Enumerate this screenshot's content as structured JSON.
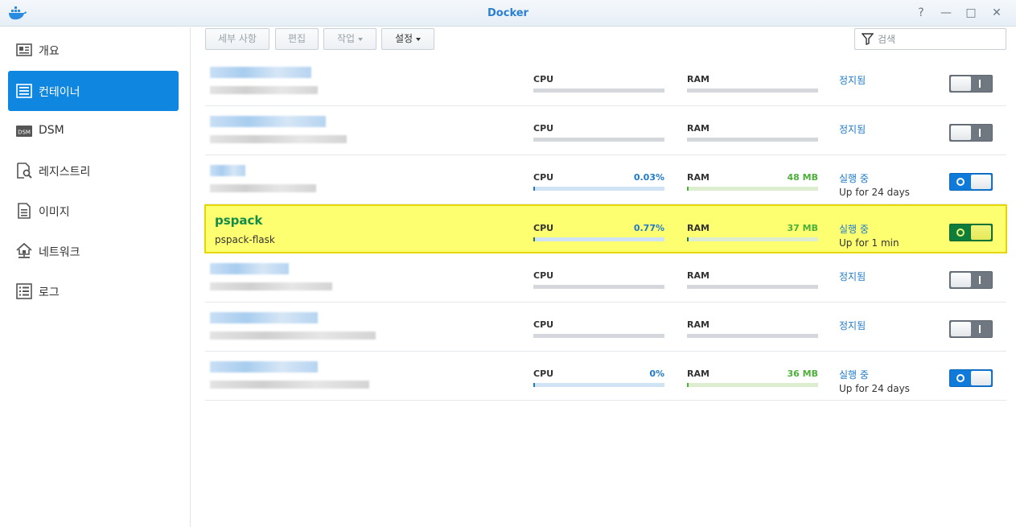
{
  "window": {
    "title": "Docker",
    "buttons": [
      "?",
      "—",
      "□",
      "✕"
    ],
    "app_icon": "docker-whale-icon"
  },
  "sidebar": {
    "items": [
      {
        "label": "개요",
        "icon": "overview-icon",
        "active": false
      },
      {
        "label": "컨테이너",
        "icon": "container-icon",
        "active": true
      },
      {
        "label": "DSM",
        "icon": "dsm-icon",
        "active": false
      },
      {
        "label": "레지스트리",
        "icon": "registry-icon",
        "active": false
      },
      {
        "label": "이미지",
        "icon": "image-icon",
        "active": false
      },
      {
        "label": "네트워크",
        "icon": "network-icon",
        "active": false
      },
      {
        "label": "로그",
        "icon": "log-icon",
        "active": false
      }
    ]
  },
  "toolbar": {
    "details_label": "세부 사항",
    "edit_label": "편집",
    "action_label": "작업",
    "settings_label": "설정",
    "search_placeholder": "검색"
  },
  "labels": {
    "cpu": "CPU",
    "ram": "RAM"
  },
  "containers": [
    {
      "name": "",
      "image": "",
      "blurred": true,
      "cpu": "",
      "ram": "",
      "status": "정지됨",
      "uptime": "",
      "running": false,
      "cpu_fraction": 0,
      "ram_fraction": 0
    },
    {
      "name": "",
      "image": "",
      "blurred": true,
      "cpu": "",
      "ram": "",
      "status": "정지됨",
      "uptime": "",
      "running": false,
      "cpu_fraction": 0,
      "ram_fraction": 0
    },
    {
      "name": "",
      "image": "",
      "blurred": true,
      "cpu": "0.03%",
      "ram": "48 MB",
      "status": "실행 중",
      "uptime": "Up for 24 days",
      "running": true,
      "cpu_fraction": 0.0003,
      "ram_fraction": 0.01
    },
    {
      "name": "pspack",
      "image": "pspack-flask",
      "blurred": false,
      "highlighted": true,
      "cpu": "0.77%",
      "ram": "37 MB",
      "status": "실행 중",
      "uptime": "Up for 1 min",
      "running": true,
      "cpu_fraction": 0.0077,
      "ram_fraction": 0.01
    },
    {
      "name": "",
      "image": "",
      "blurred": true,
      "cpu": "",
      "ram": "",
      "status": "정지됨",
      "uptime": "",
      "running": false,
      "cpu_fraction": 0,
      "ram_fraction": 0
    },
    {
      "name": "",
      "image": "",
      "blurred": true,
      "cpu": "",
      "ram": "",
      "status": "정지됨",
      "uptime": "",
      "running": false,
      "cpu_fraction": 0,
      "ram_fraction": 0
    },
    {
      "name": "",
      "image": "",
      "blurred": true,
      "cpu": "0%",
      "ram": "36 MB",
      "status": "실행 중",
      "uptime": "Up for 24 days",
      "running": true,
      "cpu_fraction": 0,
      "ram_fraction": 0.01
    }
  ],
  "colors": {
    "accent": "#0f86e0",
    "status_text": "#1e7ac9",
    "cpu_value": "#1e7ac9",
    "ram_value": "#4caf3a",
    "highlight": "#feff70",
    "running_name": "#128c48"
  }
}
